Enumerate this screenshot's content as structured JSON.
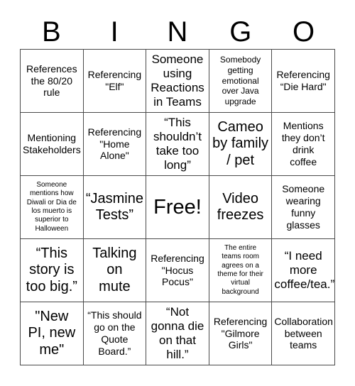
{
  "card": {
    "header_letters": [
      "B",
      "I",
      "N",
      "G",
      "O"
    ],
    "rows": [
      [
        {
          "text": "References\nthe 80/20\nrule",
          "size": "md"
        },
        {
          "text": "Referencing\n\"Elf\"",
          "size": "md"
        },
        {
          "text": "Someone\nusing\nReactions\nin Teams",
          "size": "lg"
        },
        {
          "text": "Somebody\ngetting\nemotional\nover Java\nupgrade",
          "size": "sm"
        },
        {
          "text": "Referencing\n“Die Hard\"",
          "size": "md"
        }
      ],
      [
        {
          "text": "Mentioning\nStakeholders",
          "size": "md"
        },
        {
          "text": "Referencing\n\"Home\nAlone\"",
          "size": "md"
        },
        {
          "text": "“This\nshouldn’t\ntake too\nlong”",
          "size": "lg"
        },
        {
          "text": "Cameo\nby family\n/ pet",
          "size": "xl"
        },
        {
          "text": "Mentions\nthey don’t\ndrink\ncoffee",
          "size": "md"
        }
      ],
      [
        {
          "text": "Someone\nmentions how\nDiwali or Dia de\nlos muerto is\nsuperior to\nHalloween",
          "size": "xs"
        },
        {
          "text": "“Jasmine\nTests”",
          "size": "xl"
        },
        {
          "text": "Free!",
          "size": "xxl"
        },
        {
          "text": "Video\nfreezes",
          "size": "xl"
        },
        {
          "text": "Someone\nwearing\nfunny\nglasses",
          "size": "md"
        }
      ],
      [
        {
          "text": "“This\nstory is\ntoo big.”",
          "size": "xl"
        },
        {
          "text": "Talking\non\nmute",
          "size": "xl"
        },
        {
          "text": "Referencing\n\"Hocus\nPocus\"",
          "size": "md"
        },
        {
          "text": "The entire\nteams room\nagrees on a\ntheme for their\nvirtual\nbackground",
          "size": "xs"
        },
        {
          "text": "“I need\nmore\ncoffee/tea.”",
          "size": "lg"
        }
      ],
      [
        {
          "text": "\"New\nPI, new\nme\"",
          "size": "xl"
        },
        {
          "text": "“This should\ngo on the\nQuote\nBoard.”",
          "size": "md"
        },
        {
          "text": "“Not\ngonna die\non that\nhill.”",
          "size": "lg"
        },
        {
          "text": "Referencing\n\"Gilmore\nGirls\"",
          "size": "md"
        },
        {
          "text": "Collaboration\nbetween\nteams",
          "size": "md"
        }
      ]
    ]
  },
  "colors": {
    "grid_line": "#4a4a4a",
    "text": "#000000",
    "background": "#ffffff"
  }
}
